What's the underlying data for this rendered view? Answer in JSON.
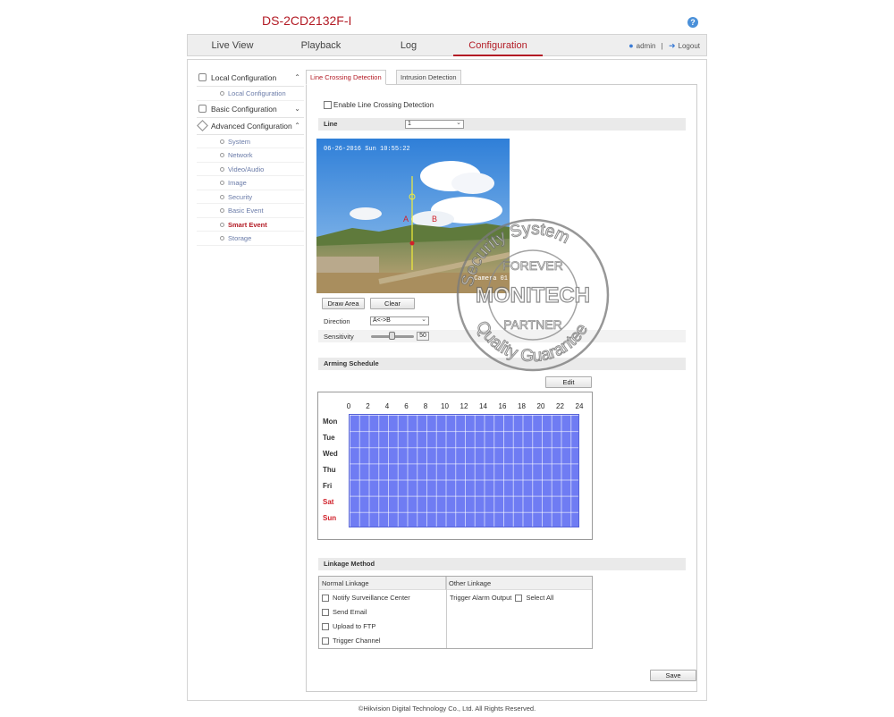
{
  "header": {
    "model": "DS-2CD2132F-I",
    "help_symbol": "?",
    "nav": [
      "Live View",
      "Playback",
      "Log",
      "Configuration"
    ],
    "user": "admin",
    "separator": "|",
    "logout": "Logout"
  },
  "sidebar": {
    "local": {
      "label": "Local Configuration",
      "arrow": "⌃",
      "items": [
        "Local Configuration"
      ]
    },
    "basic": {
      "label": "Basic Configuration",
      "arrow": "⌄"
    },
    "advanced": {
      "label": "Advanced Configuration",
      "arrow": "⌃",
      "items": [
        "System",
        "Network",
        "Video/Audio",
        "Image",
        "Security",
        "Basic Event",
        "Smart Event",
        "Storage"
      ]
    }
  },
  "tabs": [
    "Line Crossing Detection",
    "Intrusion Detection"
  ],
  "form": {
    "enable_label": "Enable Line Crossing Detection",
    "line_label": "Line",
    "line_value": "1",
    "draw_area": "Draw Area",
    "clear": "Clear",
    "direction_label": "Direction",
    "direction_value": "A<->B",
    "sensitivity_label": "Sensitivity",
    "sensitivity_value": "50"
  },
  "video": {
    "timestamp": "06-26-2016 Sun 10:55:22",
    "camera": "Camera 01",
    "label_a": "A",
    "label_b": "B"
  },
  "schedule": {
    "title": "Arming Schedule",
    "edit": "Edit",
    "hours": [
      "0",
      "2",
      "4",
      "6",
      "8",
      "10",
      "12",
      "14",
      "16",
      "18",
      "20",
      "22",
      "24"
    ],
    "days": [
      "Mon",
      "Tue",
      "Wed",
      "Thu",
      "Fri",
      "Sat",
      "Sun"
    ]
  },
  "linkage": {
    "title": "Linkage Method",
    "normal_head": "Normal Linkage",
    "other_head": "Other Linkage",
    "normal": [
      "Notify Surveillance Center",
      "Send Email",
      "Upload to FTP",
      "Trigger Channel"
    ],
    "trigger_alarm": "Trigger Alarm Output",
    "select_all": "Select All"
  },
  "save": "Save",
  "footer": "©Hikvision Digital Technology Co., Ltd. All Rights Reserved.",
  "watermark": {
    "top": "Security System",
    "forever": "FOREVER",
    "brand": "MONITECH",
    "partner": "PARTNER",
    "bottom": "Quality Guarantee"
  },
  "colors": {
    "accent": "#b31b25",
    "schedule": "#6f7cf3"
  }
}
